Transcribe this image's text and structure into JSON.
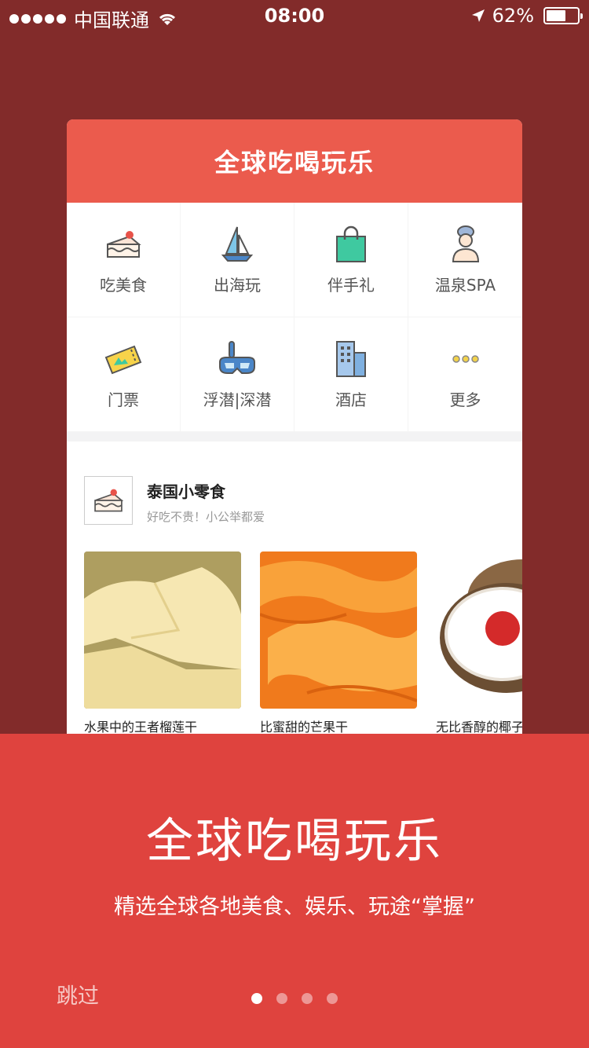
{
  "status_bar": {
    "carrier": "中国联通",
    "time": "08:00",
    "battery": "62%",
    "battery_level": 0.62
  },
  "card": {
    "header_title": "全球吃喝玩乐",
    "categories": [
      {
        "label": "吃美食",
        "icon": "cake-icon"
      },
      {
        "label": "出海玩",
        "icon": "sailboat-icon"
      },
      {
        "label": "伴手礼",
        "icon": "shopping-bag-icon"
      },
      {
        "label": "温泉SPA",
        "icon": "spa-person-icon"
      },
      {
        "label": "门票",
        "icon": "ticket-icon"
      },
      {
        "label": "浮潜|深潜",
        "icon": "diving-mask-icon"
      },
      {
        "label": "酒店",
        "icon": "hotel-building-icon"
      },
      {
        "label": "更多",
        "icon": "more-dots-icon"
      }
    ],
    "section": {
      "title": "泰国小零食",
      "subtitle": "好吃不贵！小公举都爱",
      "products": [
        {
          "name": "水果中的王者榴莲干"
        },
        {
          "name": "比蜜甜的芒果干"
        },
        {
          "name": "无比香醇的椰子"
        }
      ]
    }
  },
  "bottom": {
    "title": "全球吃喝玩乐",
    "subtitle": "精选全球各地美食、娱乐、玩途“掌握”",
    "skip_label": "跳过",
    "page_count": 4,
    "active_page": 1
  },
  "colors": {
    "background": "#822b2a",
    "card_header": "#eb5b4d",
    "bottom_panel": "#df433e"
  }
}
